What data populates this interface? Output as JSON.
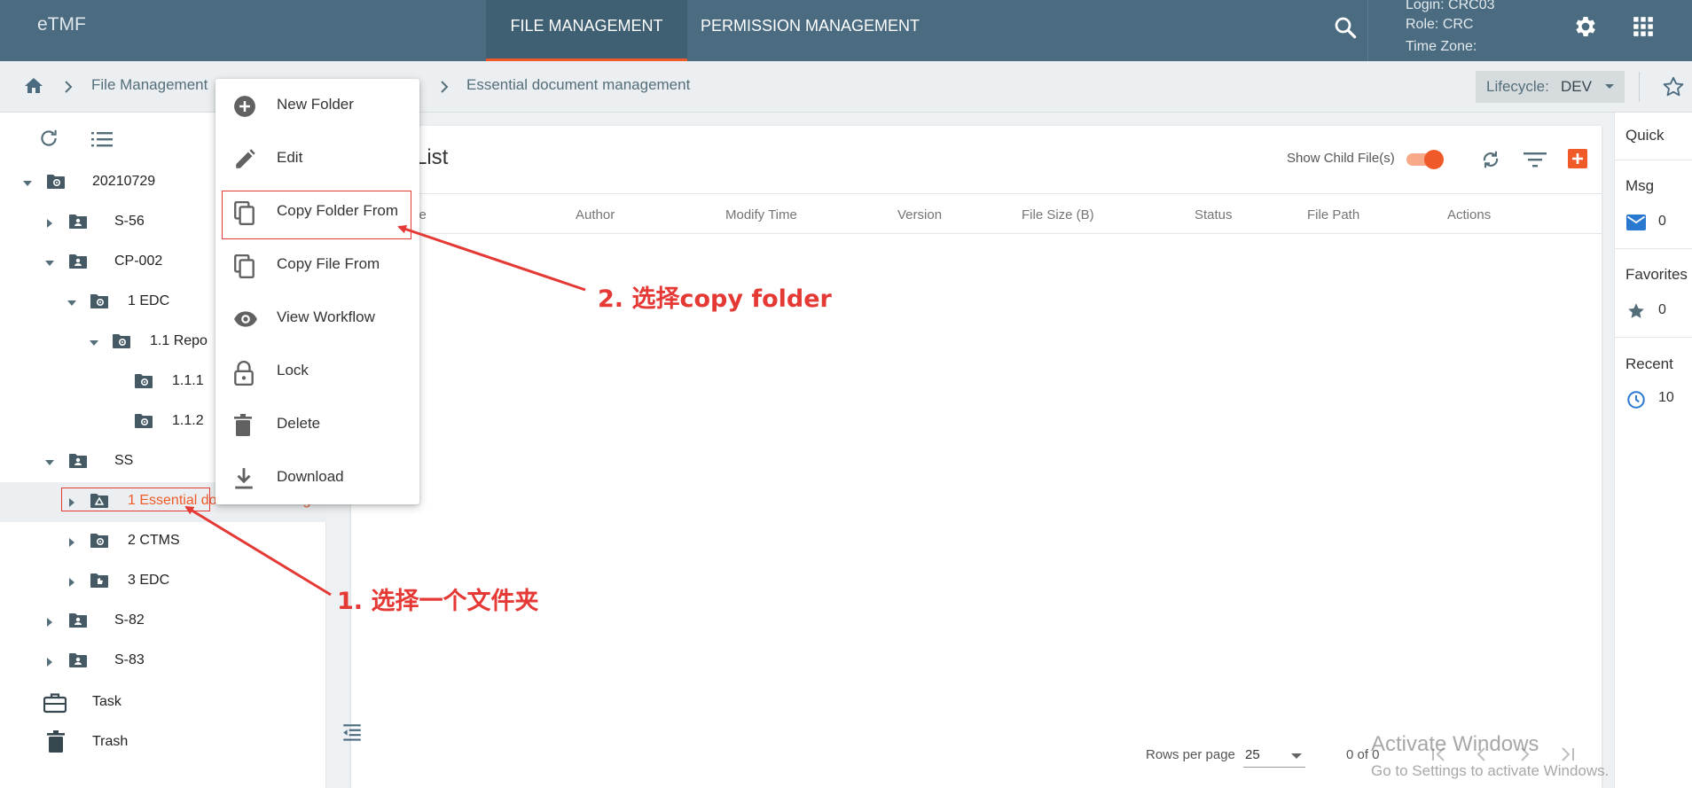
{
  "app": {
    "brand": "eTMF",
    "tabs": [
      {
        "label": "FILE MANAGEMENT",
        "active": true
      },
      {
        "label": "PERMISSION MANAGEMENT",
        "active": false
      }
    ],
    "user": {
      "login_label": "Login:",
      "login_value": "CRC03",
      "role_label": "Role:",
      "role_value": "CRC",
      "timezone_label": "Time Zone:",
      "timezone_value": ""
    },
    "colors": {
      "header": "#4a6b80",
      "accent": "#f05a28",
      "annotation": "#e53935"
    }
  },
  "breadcrumb": {
    "items": [
      "File Management",
      "Essential document management"
    ],
    "lifecycle_label": "Lifecycle:",
    "lifecycle_value": "DEV"
  },
  "tree": {
    "nodes": [
      {
        "label": "20210729",
        "level": 0,
        "expanded": true,
        "icon": "folder-gear-icon"
      },
      {
        "label": "S-56",
        "level": 1,
        "expanded": false,
        "icon": "folder-user-icon"
      },
      {
        "label": "CP-002",
        "level": 1,
        "expanded": true,
        "icon": "folder-user-icon"
      },
      {
        "label": "1  EDC",
        "level": 2,
        "expanded": true,
        "icon": "folder-gear-icon"
      },
      {
        "label": "1.1  Repo",
        "level": 3,
        "expanded": true,
        "icon": "folder-gear-icon"
      },
      {
        "label": "1.1.1",
        "level": 4,
        "expanded": null,
        "icon": "folder-gear-icon"
      },
      {
        "label": "1.1.2",
        "level": 4,
        "expanded": null,
        "icon": "folder-gear-icon"
      },
      {
        "label": "SS",
        "level": 1,
        "expanded": true,
        "icon": "folder-user-icon"
      },
      {
        "label": "1  Essential document manage",
        "level": 2,
        "expanded": false,
        "icon": "folder-shared-icon",
        "selected": true
      },
      {
        "label": "2  CTMS",
        "level": 2,
        "expanded": false,
        "icon": "folder-gear-icon"
      },
      {
        "label": "3  EDC",
        "level": 2,
        "expanded": false,
        "icon": "folder-hand-icon"
      },
      {
        "label": "S-82",
        "level": 1,
        "expanded": false,
        "icon": "folder-user-icon"
      },
      {
        "label": "S-83",
        "level": 1,
        "expanded": false,
        "icon": "folder-user-icon"
      }
    ],
    "task_label": "Task",
    "trash_label": "Trash"
  },
  "context_menu": {
    "items": [
      {
        "label": "New Folder",
        "icon": "add-circle-icon"
      },
      {
        "label": "Edit",
        "icon": "pencil-icon"
      },
      {
        "label": "Copy Folder From",
        "icon": "copy-icon",
        "highlighted": true
      },
      {
        "label": "Copy File From",
        "icon": "copy-icon"
      },
      {
        "label": "View Workflow",
        "icon": "eye-icon"
      },
      {
        "label": "Lock",
        "icon": "lock-icon"
      },
      {
        "label": "Delete",
        "icon": "trash-icon"
      },
      {
        "label": "Download",
        "icon": "download-icon"
      }
    ]
  },
  "file_list": {
    "title": "List",
    "show_child_label": "Show Child File(s)",
    "show_child_on": true,
    "columns": [
      "me",
      "Author",
      "Modify Time",
      "Version",
      "File Size (B)",
      "Status",
      "File Path",
      "Actions"
    ],
    "rows": [],
    "pagination": {
      "rows_per_page_label": "Rows per page",
      "rows_per_page": "25",
      "range": "0 of 0"
    }
  },
  "quick": {
    "title": "Quick",
    "sections": [
      {
        "label": "Msg",
        "count": "0",
        "icon": "mail-icon"
      },
      {
        "label": "Favorites",
        "count": "0",
        "icon": "star-icon"
      },
      {
        "label": "Recent",
        "count": "10",
        "icon": "clock-icon"
      }
    ]
  },
  "annotations": {
    "step1": "1. 选择一个文件夹",
    "step2": "2. 选择copy folder"
  },
  "watermark": {
    "line1": "Activate Windows",
    "line2": "Go to Settings to activate Windows."
  }
}
